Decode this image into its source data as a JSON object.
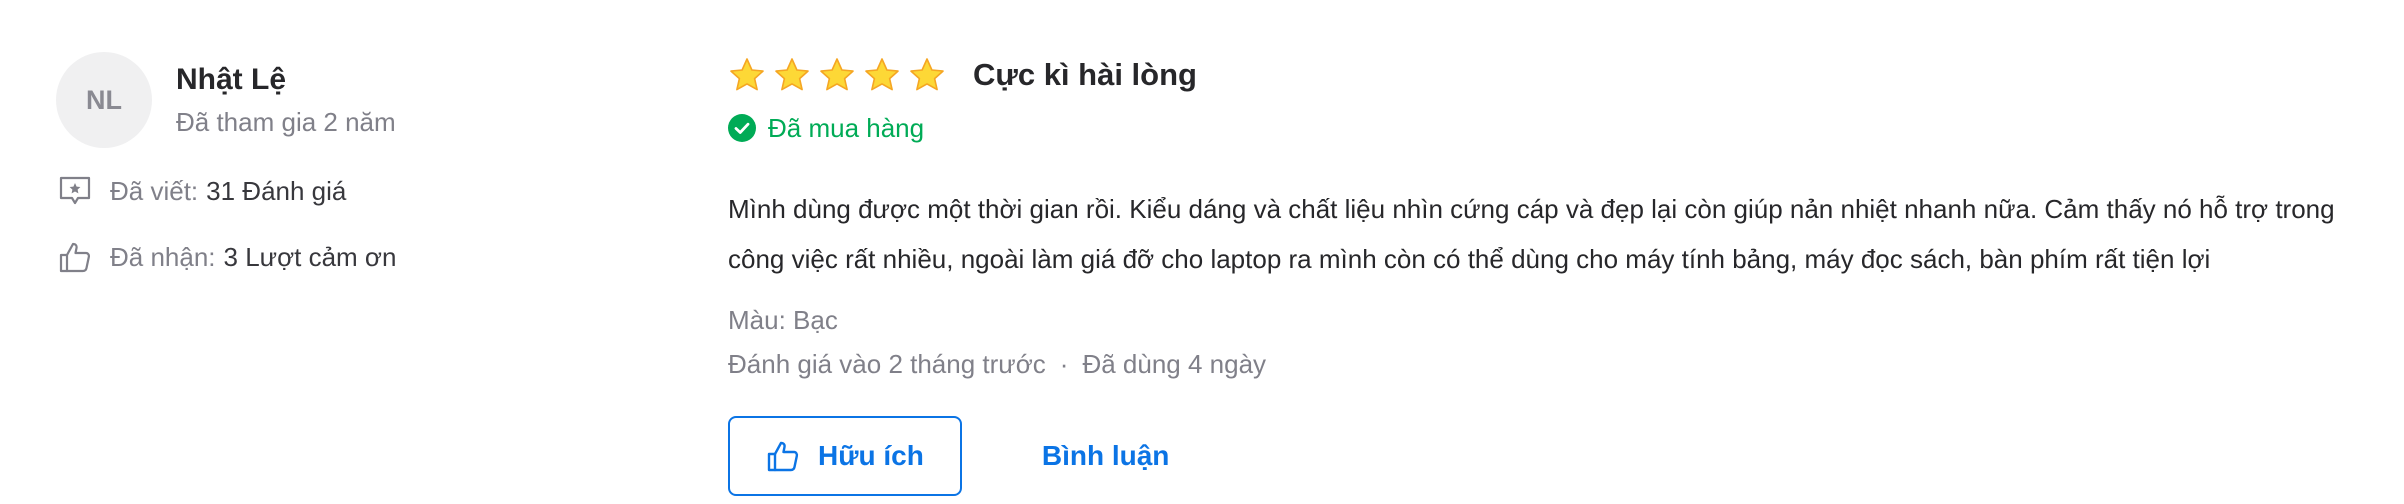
{
  "colors": {
    "accent": "#0b74e5",
    "verified": "#00ab56",
    "star": "#fdd836",
    "muted_text": "#808089",
    "avatar_bg": "#f0f0f1"
  },
  "reviewer": {
    "avatar_initials": "NL",
    "name": "Nhật Lệ",
    "joined": "Đã tham gia 2 năm",
    "stats": [
      {
        "icon": "review-comment-icon",
        "label": "Đã viết:",
        "value": "31 Đánh giá"
      },
      {
        "icon": "thumbs-up-icon",
        "label": "Đã nhận:",
        "value": "3 Lượt cảm ơn"
      }
    ]
  },
  "review": {
    "rating": 5,
    "rating_max": 5,
    "rating_title": "Cực kì hài lòng",
    "purchased_label": "Đã mua hàng",
    "text": "Mình dùng được một thời gian rồi. Kiểu dáng và chất liệu nhìn cứng cáp và đẹp lại còn giúp nản nhiệt nhanh nữa. Cảm thấy nó hỗ trợ trong công việc rất nhiều, ngoài làm giá đỡ cho laptop ra mình còn có thể dùng cho máy tính bảng, máy đọc sách, bàn phím rất tiện lợi",
    "attribute": "Màu: Bạc",
    "reviewed_time": "Đánh giá vào 2 tháng trước",
    "separator": "·",
    "usage_time": "Đã dùng 4 ngày"
  },
  "actions": {
    "helpful_label": "Hữu ích",
    "comment_label": "Bình luận"
  }
}
